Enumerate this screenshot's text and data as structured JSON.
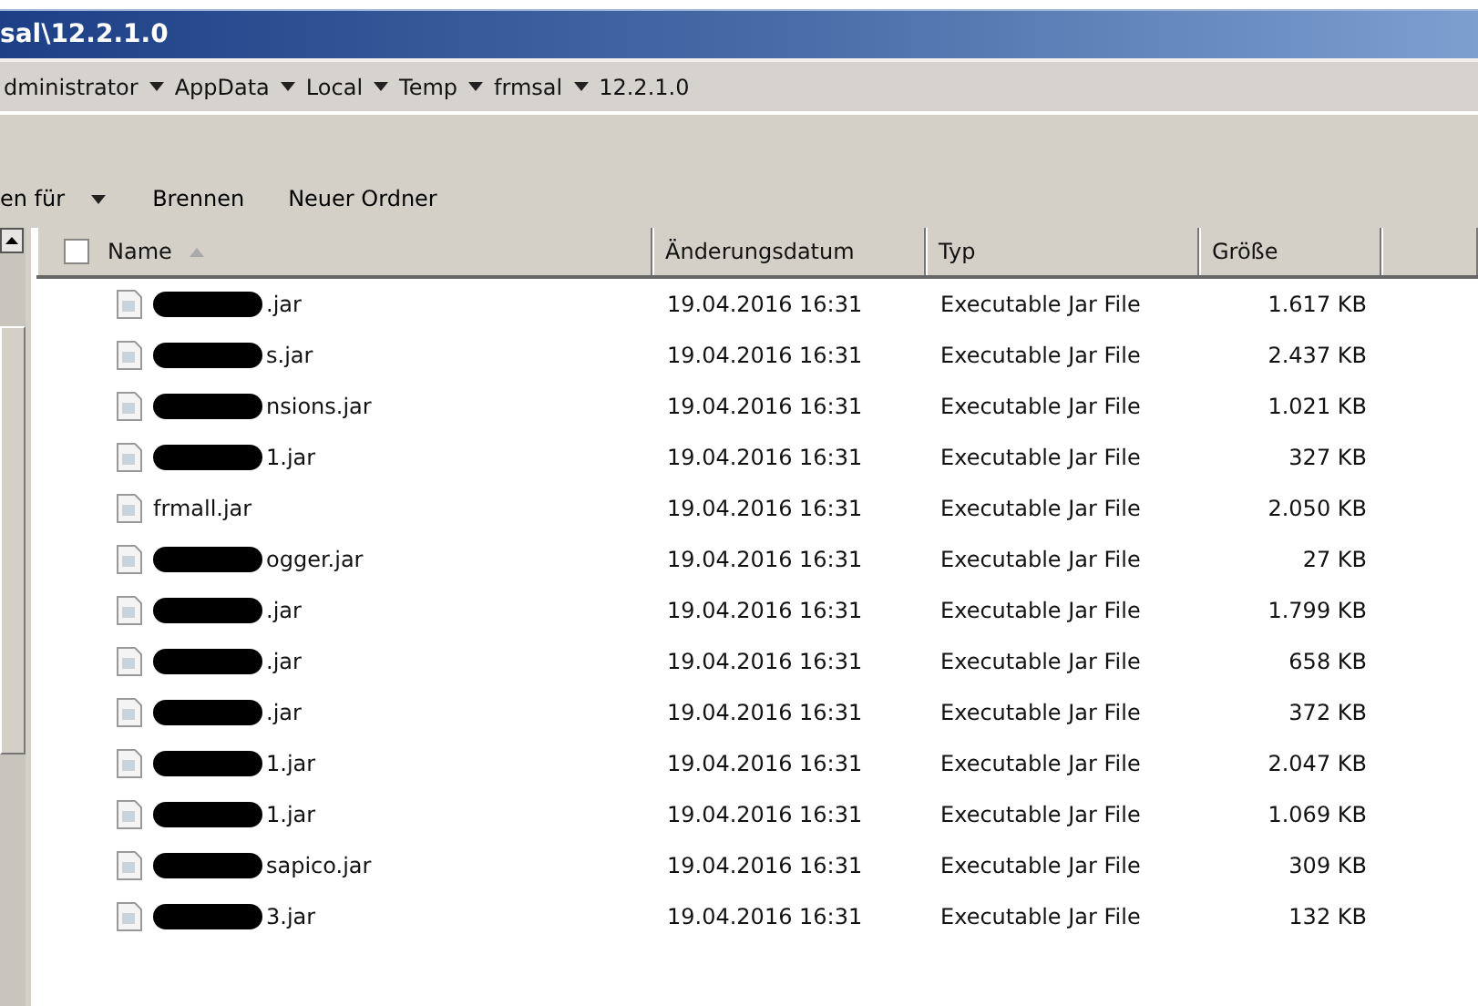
{
  "window": {
    "title": "sal\\12.2.1.0"
  },
  "breadcrumb": [
    "dministrator",
    "AppData",
    "Local",
    "Temp",
    "frmsal",
    "12.2.1.0"
  ],
  "toolbar": [
    {
      "label": "en für",
      "dropdown": true
    },
    {
      "label": "Brennen",
      "dropdown": false
    },
    {
      "label": "Neuer Ordner",
      "dropdown": false
    }
  ],
  "table": {
    "select_all": {
      "checked": false
    },
    "columns": [
      "Name",
      "Änderungsdatum",
      "Typ",
      "Größe"
    ],
    "rows": [
      {
        "name": ".jar",
        "redacted": true,
        "date": "19.04.2016 16:31",
        "type": "Executable Jar File",
        "size": "1.617 KB"
      },
      {
        "name": "s.jar",
        "redacted": true,
        "date": "19.04.2016 16:31",
        "type": "Executable Jar File",
        "size": "2.437 KB"
      },
      {
        "name": "nsions.jar",
        "redacted": true,
        "date": "19.04.2016 16:31",
        "type": "Executable Jar File",
        "size": "1.021 KB"
      },
      {
        "name": "1.jar",
        "redacted": true,
        "date": "19.04.2016 16:31",
        "type": "Executable Jar File",
        "size": "327 KB"
      },
      {
        "name": "frmall.jar",
        "redacted": false,
        "date": "19.04.2016 16:31",
        "type": "Executable Jar File",
        "size": "2.050 KB"
      },
      {
        "name": "ogger.jar",
        "redacted": true,
        "date": "19.04.2016 16:31",
        "type": "Executable Jar File",
        "size": "27 KB"
      },
      {
        "name": ".jar",
        "redacted": true,
        "date": "19.04.2016 16:31",
        "type": "Executable Jar File",
        "size": "1.799 KB"
      },
      {
        "name": ".jar",
        "redacted": true,
        "date": "19.04.2016 16:31",
        "type": "Executable Jar File",
        "size": "658 KB"
      },
      {
        "name": ".jar",
        "redacted": true,
        "date": "19.04.2016 16:31",
        "type": "Executable Jar File",
        "size": "372 KB"
      },
      {
        "name": "1.jar",
        "redacted": true,
        "date": "19.04.2016 16:31",
        "type": "Executable Jar File",
        "size": "2.047 KB"
      },
      {
        "name": "1.jar",
        "redacted": true,
        "date": "19.04.2016 16:31",
        "type": "Executable Jar File",
        "size": "1.069 KB"
      },
      {
        "name": "sapico.jar",
        "redacted": true,
        "date": "19.04.2016 16:31",
        "type": "Executable Jar File",
        "size": "309 KB"
      },
      {
        "name": "3.jar",
        "redacted": true,
        "date": "19.04.2016 16:31",
        "type": "Executable Jar File",
        "size": "132 KB"
      }
    ]
  }
}
